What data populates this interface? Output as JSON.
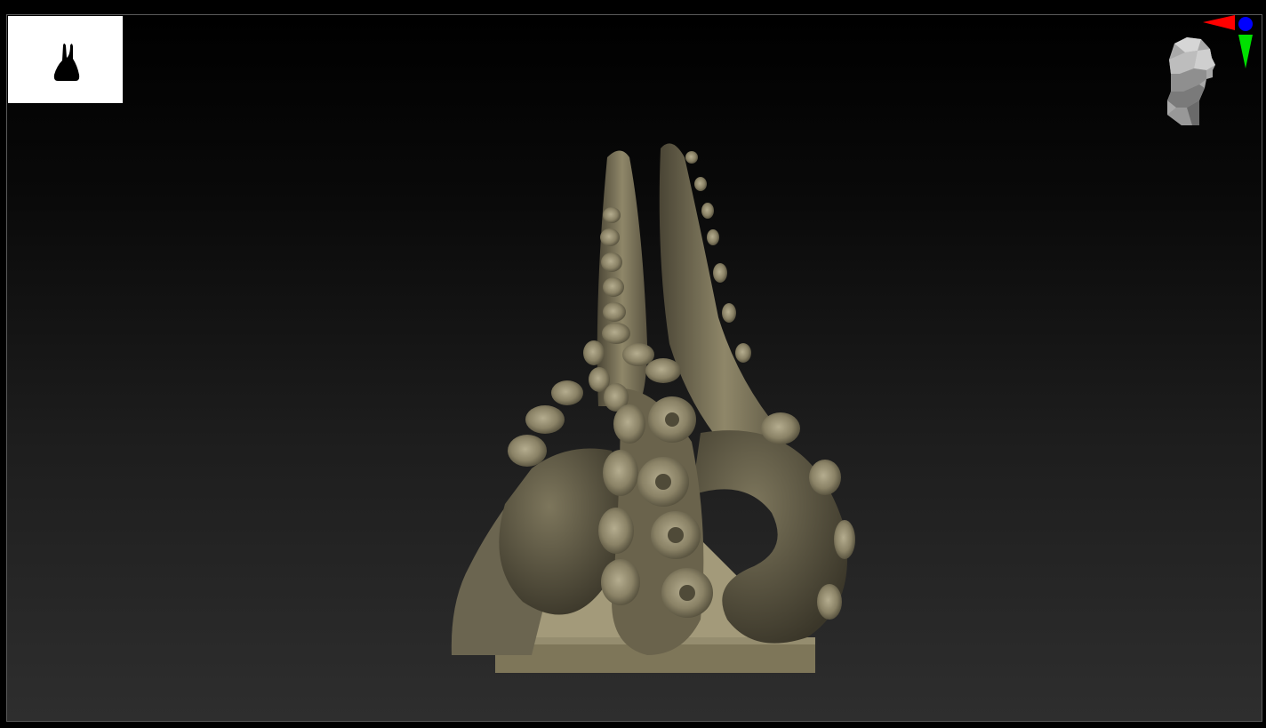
{
  "viewport": {
    "background_top": "#000000",
    "background_bottom": "#2e2e2e",
    "border_color": "#5a5a5a"
  },
  "thumbnail": {
    "background": "#ffffff",
    "silhouette_color": "#000000"
  },
  "navigator": {
    "icon": "head-navigator-icon",
    "x_axis_color": "#ff0000",
    "y_axis_color": "#00ff00",
    "z_axis_color": "#0000ff"
  },
  "model": {
    "material_color": "#8c8468",
    "shadow_color": "#4a4535"
  }
}
